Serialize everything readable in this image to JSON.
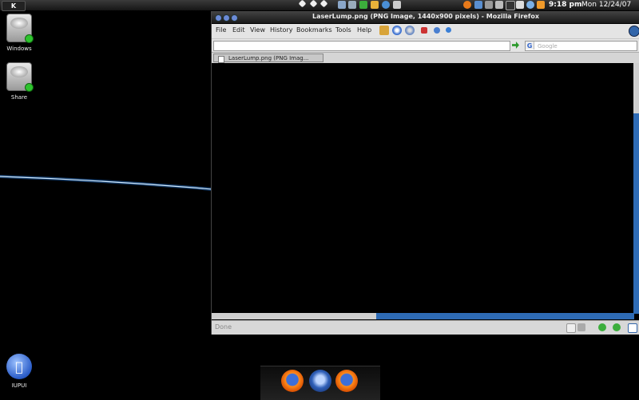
{
  "topbar": {
    "kmenu_label": "K",
    "clock": "9:18 pm",
    "date": "Mon 12/24/07",
    "tray_icons": [
      "task-icon",
      "task-icon",
      "task-icon",
      "monitor-icon",
      "chart-icon",
      "green-icon",
      "folder-icon",
      "globe-icon",
      "network-icon",
      "firefox-icon",
      "world-icon",
      "icon",
      "icon",
      "terminal-icon",
      "icon",
      "weather-icon",
      "speaker-icon"
    ]
  },
  "desktop": {
    "icons": [
      {
        "label": "Windows"
      },
      {
        "label": "Share"
      },
      {
        "label": "IUPUI"
      }
    ]
  },
  "browser": {
    "title": "LaserLump.png (PNG Image, 1440x900 pixels) - Mozilla Firefox",
    "menus": [
      "File",
      "Edit",
      "View",
      "History",
      "Bookmarks",
      "Tools",
      "Help"
    ],
    "url_value": "",
    "search_placeholder": "Google",
    "tab_label": "LaserLump.png (PNG Imag...",
    "status_text": "Done",
    "vertical_scroll_position": 0.2,
    "horizontal_scroll_position": 0.39
  },
  "dock": {
    "items": [
      "firefox-icon",
      "thunderbird-icon",
      "firefox-icon"
    ]
  },
  "colors": {
    "laser": "#9fd4ff",
    "scroll_thumb": "#2e6bb5",
    "chrome": "#e4e4e4"
  }
}
